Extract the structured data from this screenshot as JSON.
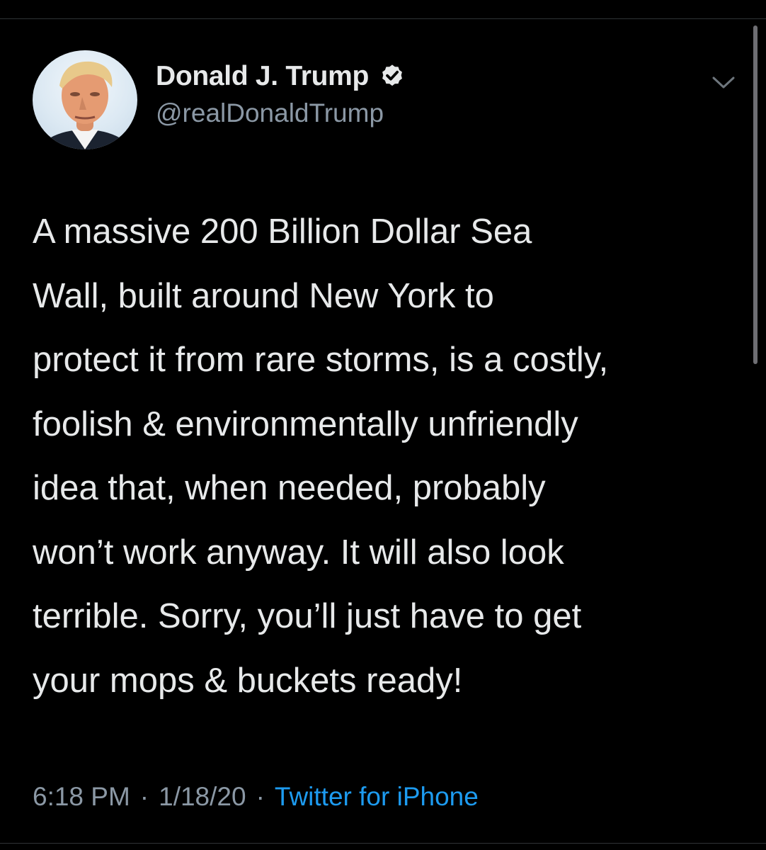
{
  "author": {
    "display_name": "Donald J. Trump",
    "handle": "@realDonaldTrump",
    "verified_icon": "verified-badge-icon",
    "avatar": "profile-photo"
  },
  "tweet": {
    "lines": [
      "A massive 200 Billion Dollar Sea",
      "Wall, built around New York to",
      "protect it from rare storms, is a costly,",
      "foolish & environmentally unfriendly",
      "idea that, when needed, probably",
      "won’t work anyway. It will also look",
      "terrible. Sorry, you’ll just have to get",
      "your mops & buckets ready!"
    ]
  },
  "meta": {
    "time": "6:18 PM",
    "separator": "·",
    "date": "1/18/20",
    "source": "Twitter for iPhone"
  },
  "menu": {
    "icon": "chevron-down-icon"
  },
  "colors": {
    "background": "#000000",
    "text_primary": "#e7e9ea",
    "text_secondary": "#8b98a5",
    "link": "#1d9bf0",
    "divider": "#2f3336"
  }
}
